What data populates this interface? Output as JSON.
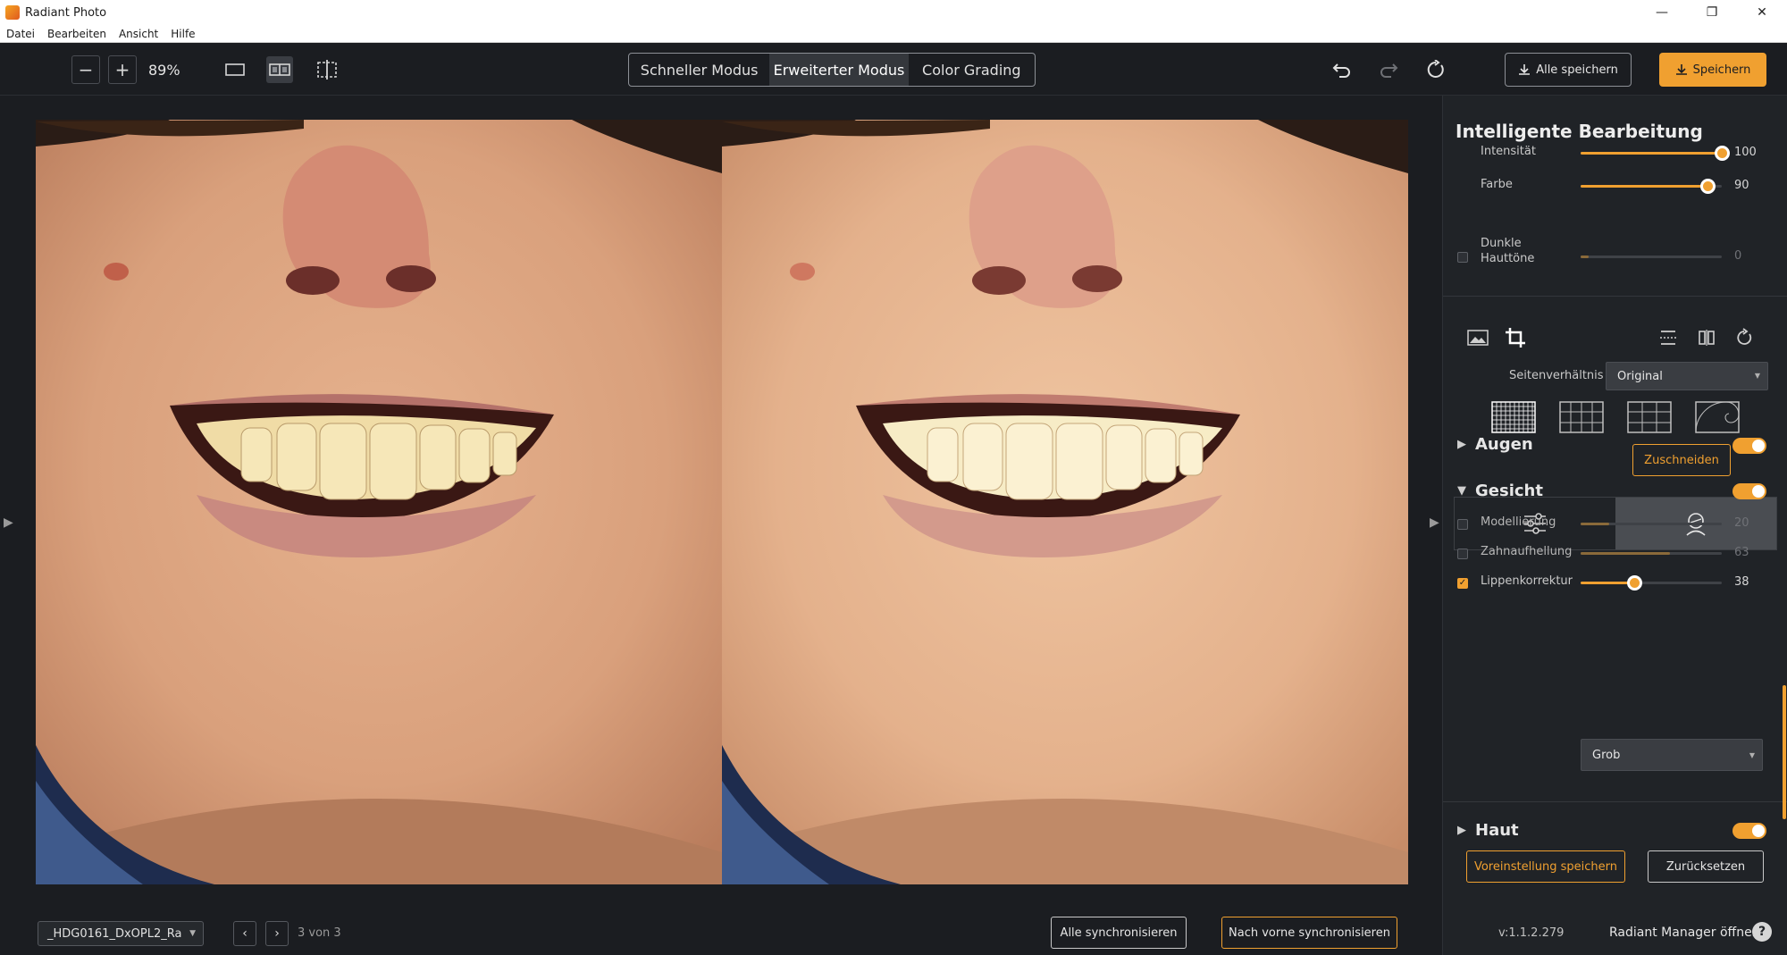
{
  "app": {
    "title": "Radiant Photo"
  },
  "window_controls": {
    "minimize": "—",
    "maximize": "❐",
    "close": "✕"
  },
  "menu": [
    "Datei",
    "Bearbeiten",
    "Ansicht",
    "Hilfe"
  ],
  "toolbar": {
    "zoom_out": "−",
    "zoom_in": "+",
    "zoom_value": "89%",
    "modes": [
      "Schneller Modus",
      "Erweiterter Modus",
      "Color Grading"
    ],
    "active_mode": "Erweiterter Modus",
    "save_all_label": "Alle speichern",
    "save_label": "Speichern"
  },
  "panel": {
    "title": "Intelligente Bearbeitung",
    "sliders": [
      {
        "label": "Intensität",
        "value": 100,
        "display": "100"
      },
      {
        "label": "Farbe",
        "value": 90,
        "display": "90"
      },
      {
        "label": "Dunkle",
        "label2": "Hauttöne",
        "value": 0,
        "display": "0"
      }
    ],
    "aspect_label": "Seitenverhältnis",
    "aspect_value": "Original",
    "crop_label": "Zuschneiden",
    "sections": {
      "eyes": "Augen",
      "face": "Gesicht",
      "skin": "Haut"
    },
    "face_sliders": [
      {
        "label": "Modellierung",
        "value": 20,
        "display": "20",
        "checked": false
      },
      {
        "label": "Zahnaufhellung",
        "value": 63,
        "display": "63",
        "checked": false
      },
      {
        "label": "Lippenkorrektur",
        "value": 38,
        "display": "38",
        "checked": true
      }
    ],
    "detail_select": "Grob",
    "preset_label": "Voreinstellung speichern",
    "reset_label": "Zurücksetzen",
    "version": "v:1.1.2.279",
    "manager_link": "Radiant Manager öffnen",
    "help": "?"
  },
  "footer": {
    "file_name": "_HDG0161_DxOPL2_Ra",
    "page_count": "3 von 3",
    "sync_all": "Alle synchronisieren",
    "sync_front": "Nach vorne synchronisieren"
  },
  "colors": {
    "accent": "#f0a030",
    "background": "#1b1d21",
    "panel": "#202327"
  }
}
